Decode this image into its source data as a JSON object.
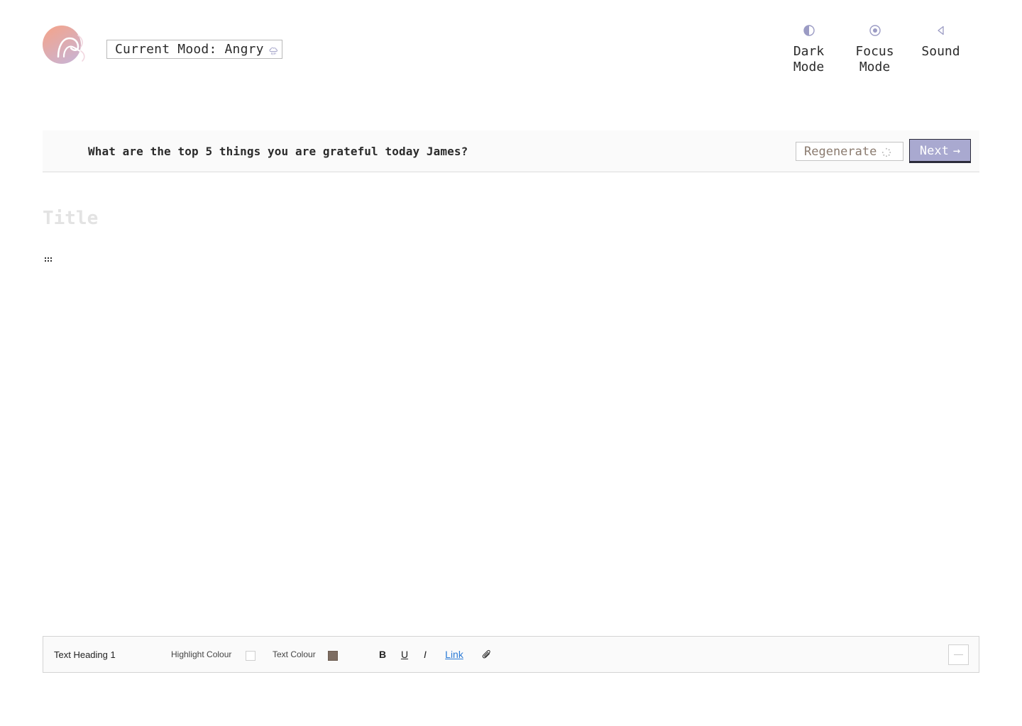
{
  "header": {
    "mood_label": "Current Mood: Angry",
    "mood_icon": "storm-cloud-icon",
    "tools": [
      {
        "label": "Dark\nMode",
        "icon": "half-circle-icon"
      },
      {
        "label": "Focus\nMode",
        "icon": "target-icon"
      },
      {
        "label": "Sound",
        "icon": "speaker-icon"
      }
    ]
  },
  "prompt": {
    "question": "What are the top 5 things you are grateful today James?",
    "regenerate_label": "Regenerate",
    "next_label": "Next",
    "next_arrow": "→"
  },
  "editor": {
    "title_placeholder": "Title",
    "title_value": ""
  },
  "toolbar": {
    "heading_style": "Text Heading 1",
    "highlight_label": "Highlight Colour",
    "highlight_color": "#ffffff",
    "text_colour_label": "Text Colour",
    "text_color": "#7d6d62",
    "bold_label": "B",
    "underline_label": "U",
    "italic_label": "I",
    "link_label": "Link"
  },
  "colors": {
    "accent": "#a9a9d0",
    "icon_tint": "#9b9bc4",
    "logo_gradient": [
      "#f3a88a",
      "#cfb0c8"
    ]
  }
}
